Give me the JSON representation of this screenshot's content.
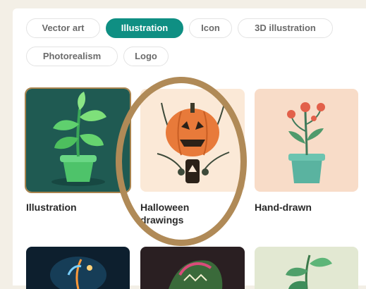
{
  "styles": {
    "chips": [
      "Vector art",
      "Illustration",
      "Icon",
      "3D illustration",
      "Photorealism",
      "Logo"
    ],
    "active": "Illustration"
  },
  "gallery": {
    "items": [
      {
        "label": "Illustration",
        "icon": "potted-plant-icon"
      },
      {
        "label": "Halloween drawings",
        "icon": "jack-o-lantern-icon"
      },
      {
        "label": "Hand-drawn",
        "icon": "flower-pot-icon"
      }
    ]
  },
  "colors": {
    "accent": "#0f8f83",
    "annotation_ring": "#b08a57"
  }
}
